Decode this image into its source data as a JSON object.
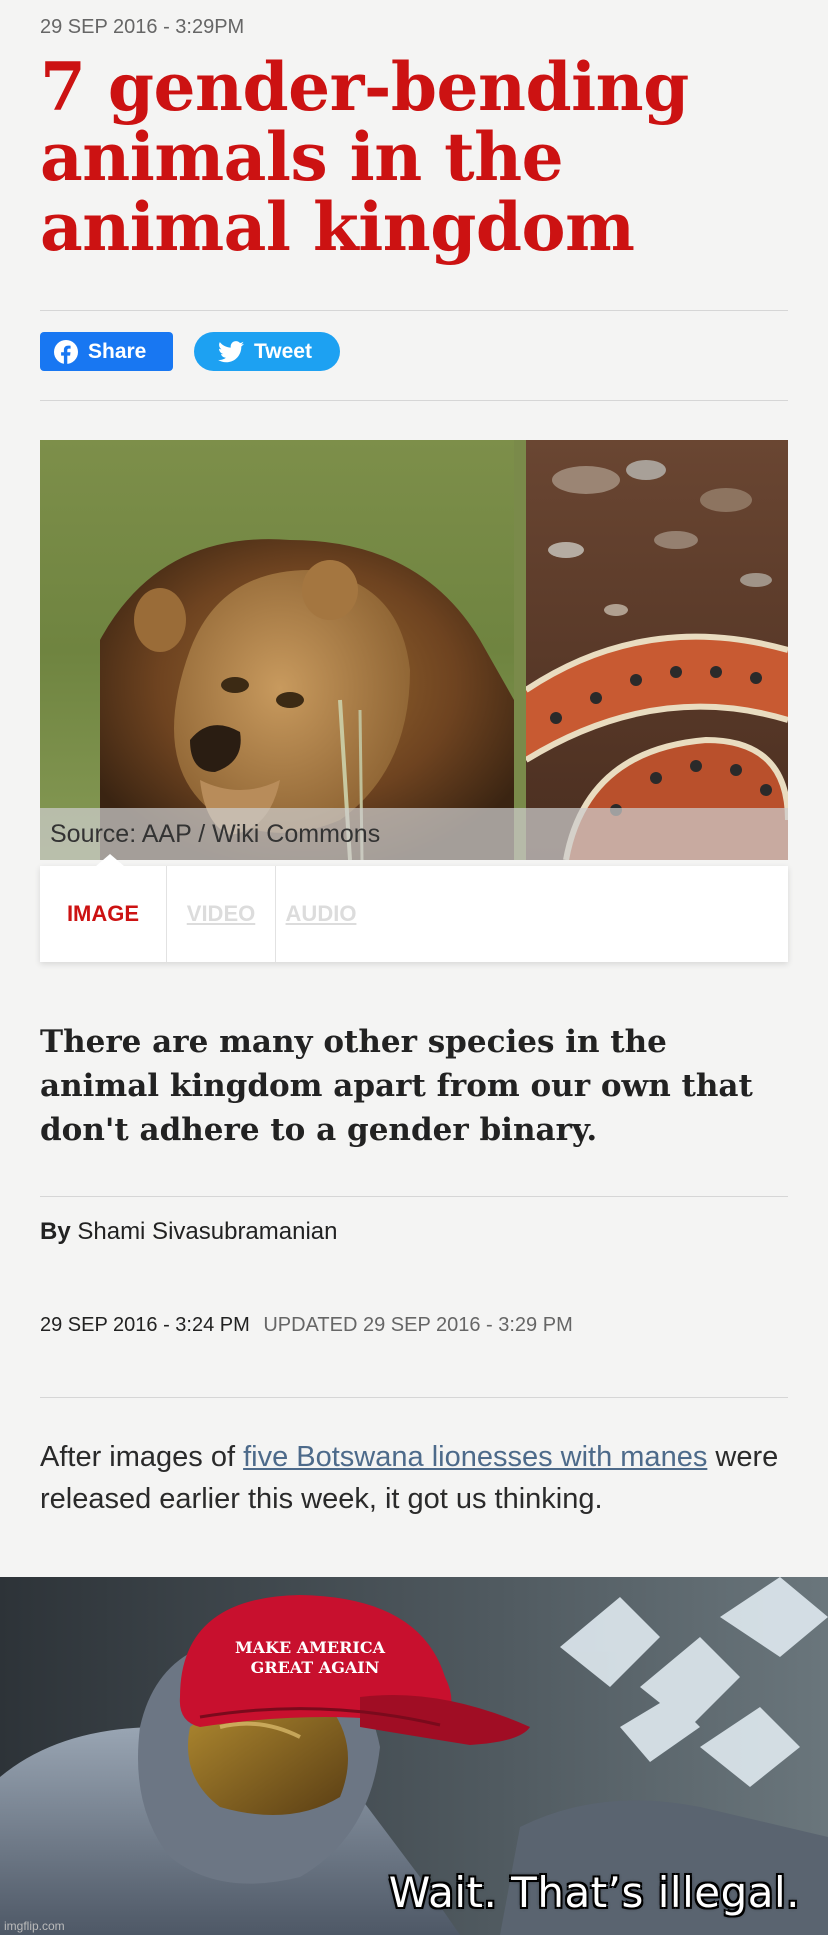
{
  "article": {
    "dateline": "29 SEP 2016 - 3:29PM",
    "headline": "7 gender-bending animals in the animal kingdom",
    "share_label": "Share",
    "tweet_label": "Tweet",
    "image_caption": "Source: AAP / Wiki Commons",
    "tabs": [
      {
        "label": "IMAGE",
        "active": true
      },
      {
        "label": "VIDEO",
        "active": false
      },
      {
        "label": "AUDIO",
        "active": false
      }
    ],
    "standfirst": "There are many other species in the animal kingdom apart from our own that don't adhere to a gender binary.",
    "byline_prefix": "By",
    "author": "Shami Sivasubramanian",
    "published": "29 SEP 2016 - 3:24 PM",
    "updated": "UPDATED 29 SEP 2016 - 3:29 PM",
    "body_before_link": "After images of ",
    "body_link": "five Botswana lionesses with manes",
    "body_after_link": " were released earlier this week, it got us thinking."
  },
  "meme": {
    "hat_text_line1": "MAKE AMERICA",
    "hat_text_line2": "GREAT AGAIN",
    "caption": "Wait. That’s illegal.",
    "watermark": "imgflip.com"
  },
  "colors": {
    "headline_red": "#cc1212",
    "facebook_blue": "#1877f2",
    "twitter_blue": "#1da1f2",
    "link": "#4d6a8a",
    "hat_red": "#c8102e"
  },
  "icons": [
    "facebook-icon",
    "twitter-bird-icon"
  ]
}
